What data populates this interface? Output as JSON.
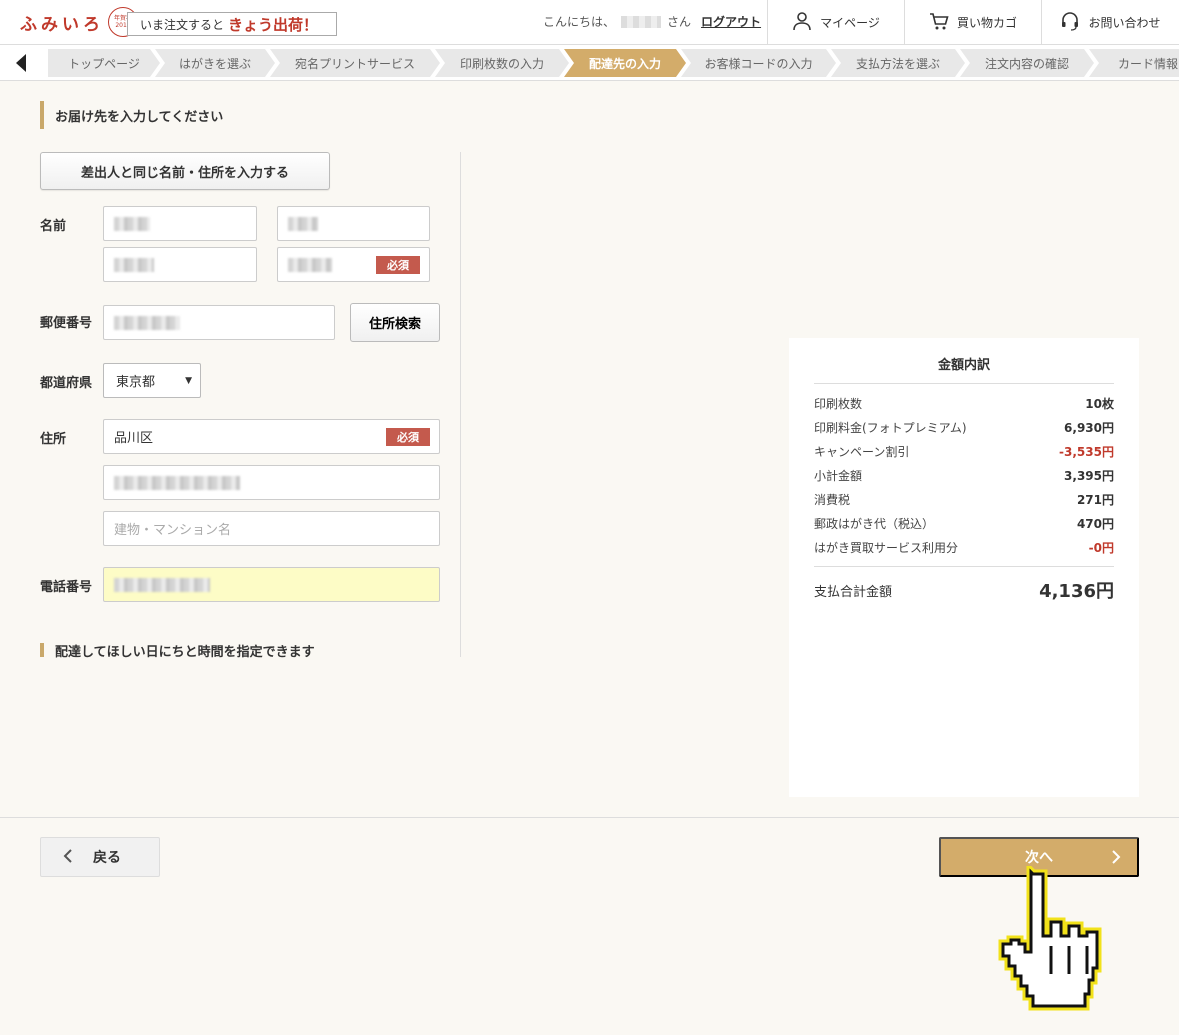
{
  "header": {
    "logo_text": "ふみいろ",
    "logo_seal": "年賀状 2018",
    "promo_prefix": "いま注文すると",
    "promo_highlight": "きょう出荷！",
    "greeting_prefix": "こんにちは、",
    "greeting_suffix": "さん",
    "logout": "ログアウト",
    "nav": [
      {
        "label": "マイページ",
        "icon": "user-icon"
      },
      {
        "label": "買い物カゴ",
        "icon": "cart-icon"
      },
      {
        "label": "お問い合わせ",
        "icon": "headset-icon"
      }
    ]
  },
  "breadcrumb": [
    {
      "label": "トップページ",
      "active": false
    },
    {
      "label": "はがきを選ぶ",
      "active": false
    },
    {
      "label": "宛名プリントサービス",
      "active": false
    },
    {
      "label": "印刷枚数の入力",
      "active": false
    },
    {
      "label": "配達先の入力",
      "active": true
    },
    {
      "label": "お客様コードの入力",
      "active": false
    },
    {
      "label": "支払方法を選ぶ",
      "active": false
    },
    {
      "label": "注文内容の確認",
      "active": false
    },
    {
      "label": "カード情報の",
      "active": false
    }
  ],
  "form": {
    "heading": "お届け先を入力してください",
    "copy_button": "差出人と同じ名前・住所を入力する",
    "name_label": "名前",
    "postal_label": "郵便番号",
    "address_search": "住所検索",
    "prefecture_label": "都道府県",
    "prefecture_value": "東京都",
    "address_label": "住所",
    "address_value": "品川区",
    "building_placeholder": "建物・マンション名",
    "phone_label": "電話番号",
    "required": "必須",
    "delivery_heading": "配達してほしい日にちと時間を指定できます"
  },
  "summary": {
    "title": "金額内訳",
    "rows": [
      {
        "label": "印刷枚数",
        "value": "10枚",
        "red": false
      },
      {
        "label": "印刷料金(フォトプレミアム)",
        "value": "6,930円",
        "red": false
      },
      {
        "label": "キャンペーン割引",
        "value": "-3,535円",
        "red": true
      },
      {
        "label": "小計金額",
        "value": "3,395円",
        "red": false
      },
      {
        "label": "消費税",
        "value": "271円",
        "red": false
      },
      {
        "label": "郵政はがき代（税込）",
        "value": "470円",
        "red": false
      },
      {
        "label": "はがき買取サービス利用分",
        "value": "-0円",
        "red": true
      }
    ],
    "total_label": "支払合計金額",
    "total_value": "4,136円"
  },
  "footer": {
    "back": "戻る",
    "next": "次へ"
  },
  "colors": {
    "accent": "#d3ac6a",
    "brand_red": "#c0392b",
    "required_badge": "#c45a4d",
    "phone_highlight": "#fdfcc6"
  }
}
